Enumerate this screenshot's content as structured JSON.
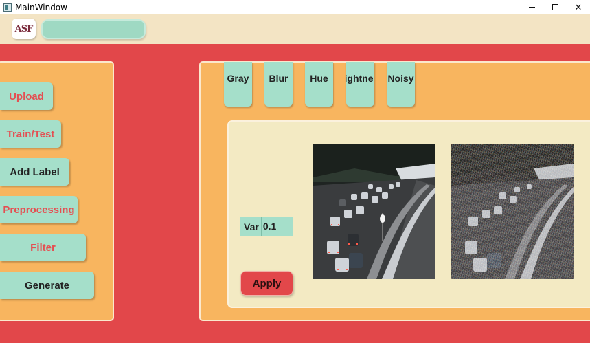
{
  "window": {
    "title": "MainWindow",
    "controls": {
      "minimize": "–",
      "maximize": "□",
      "close": "✕"
    }
  },
  "topbar": {
    "logo_text": "ASF"
  },
  "sidebar": {
    "buttons": [
      {
        "label": "Upload",
        "color": "#e44f52"
      },
      {
        "label": "Train/Test",
        "color": "#e44f52"
      },
      {
        "label": "Add Label",
        "color": "#232323"
      },
      {
        "label": "Preprocessing",
        "color": "#e44f52"
      },
      {
        "label": "Filter",
        "color": "#e44f52"
      },
      {
        "label": "Generate",
        "color": "#232323"
      }
    ]
  },
  "tabs": [
    {
      "label": "Gray"
    },
    {
      "label": "Blur"
    },
    {
      "label": "Hue"
    },
    {
      "label": "Brightness"
    },
    {
      "label": "Noisy"
    }
  ],
  "controls": {
    "var_label": "Var",
    "var_value": "0.1",
    "apply_label": "Apply"
  },
  "images": [
    {
      "name": "original-highway-image",
      "icon": "highway-photo-icon"
    },
    {
      "name": "noisy-highway-image",
      "icon": "noisy-highway-photo-icon"
    }
  ],
  "colors": {
    "background": "#e2474a",
    "panel": "#f8b55f",
    "inner_panel": "#f3eac3",
    "button": "#a5dfca",
    "topbar": "#f3e4c4",
    "accent_text": "#e44f52"
  }
}
